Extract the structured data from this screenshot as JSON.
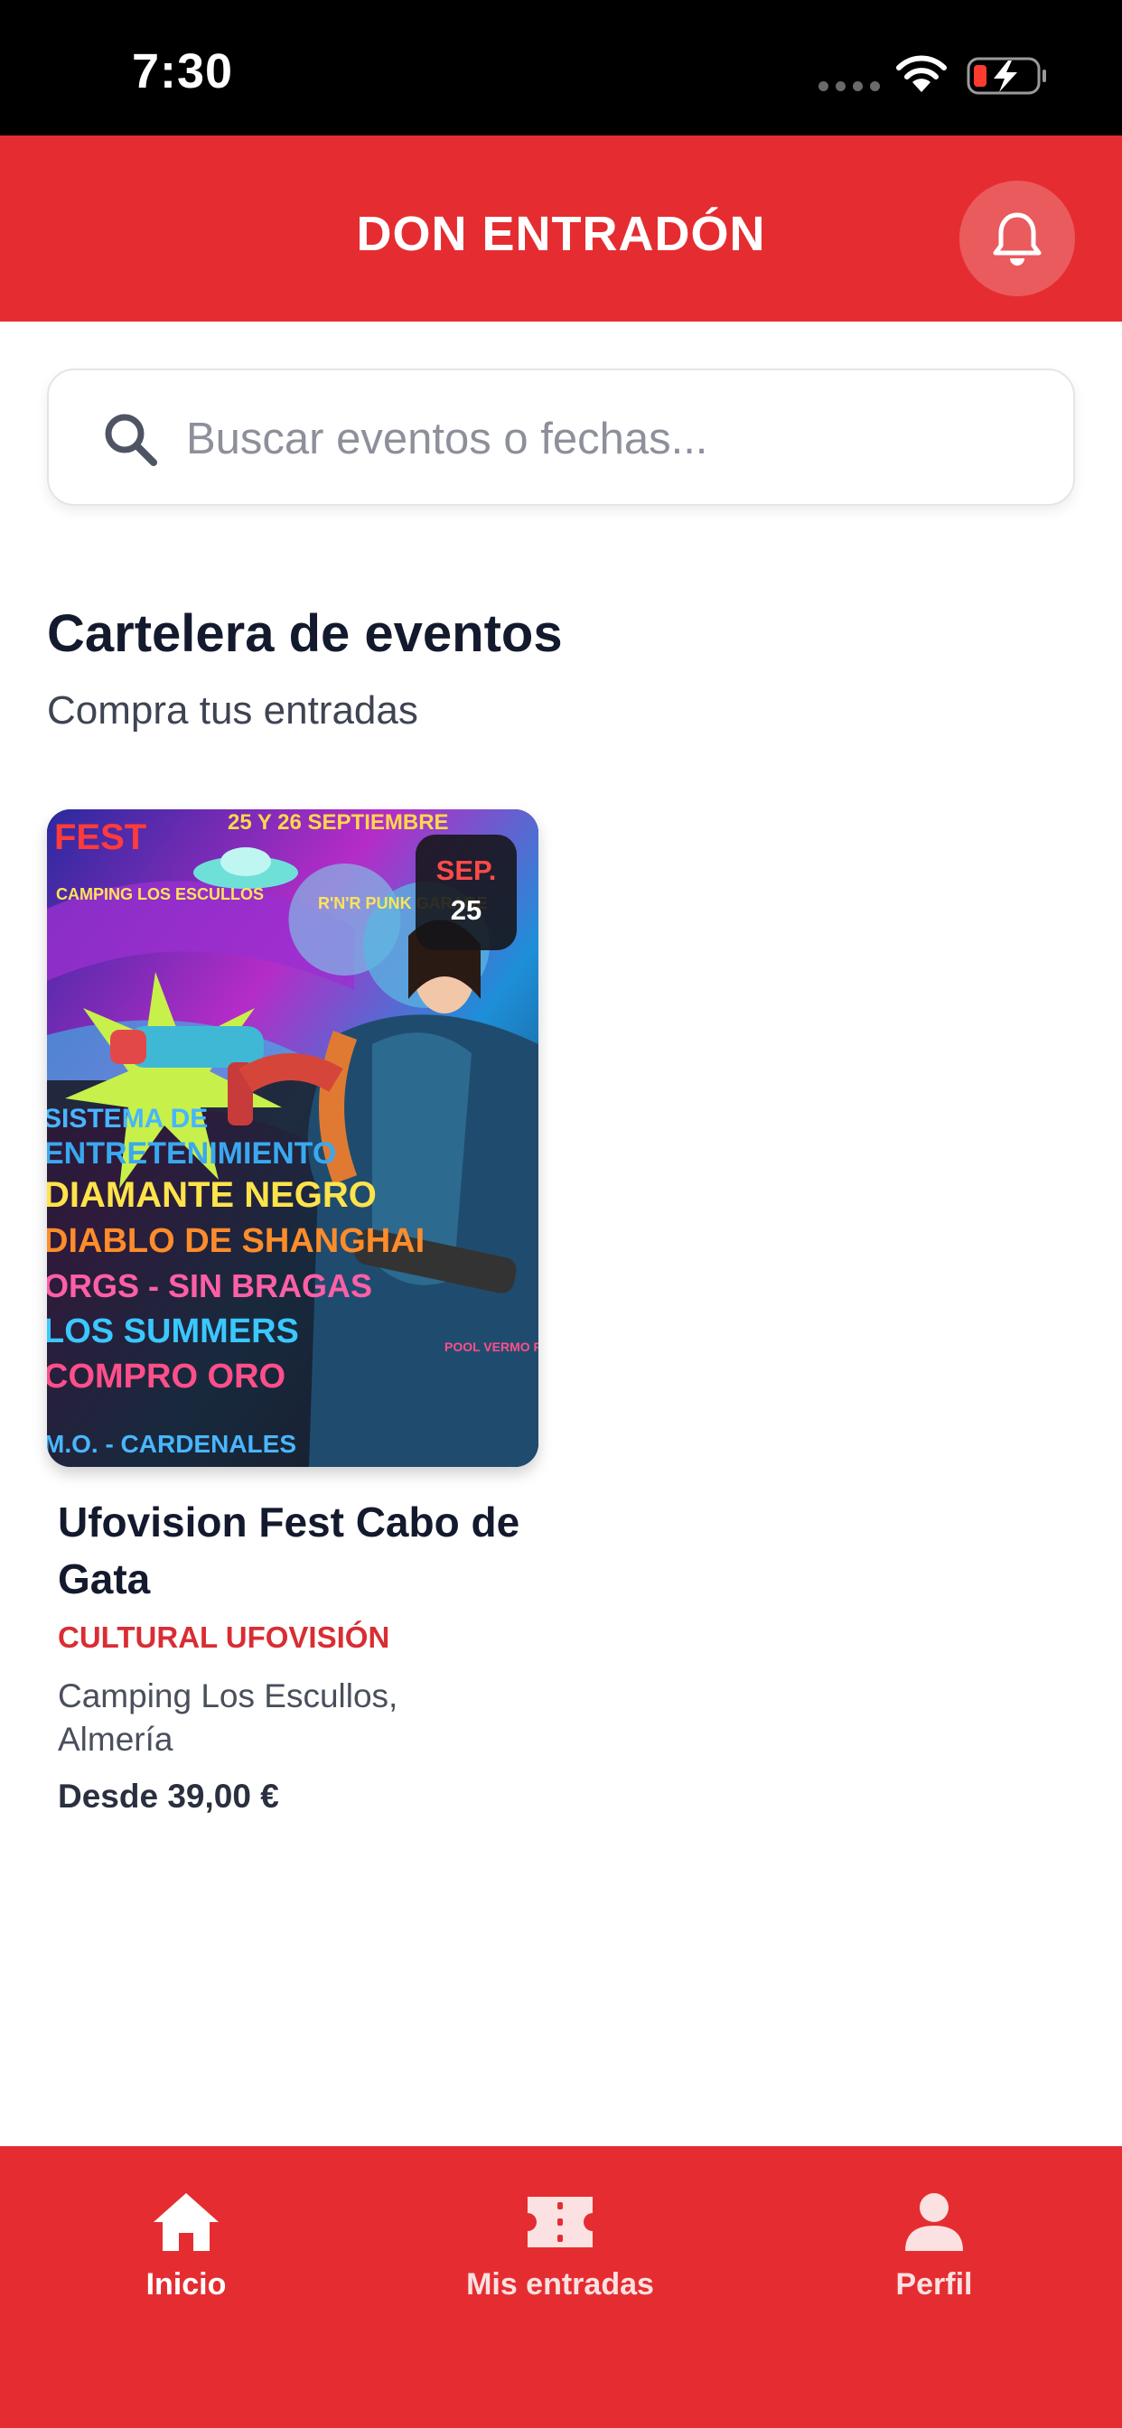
{
  "status_bar": {
    "time": "7:30",
    "wifi_icon": "wifi-icon",
    "battery_icon": "battery-charging-icon",
    "battery_color": "#ff3b30"
  },
  "header": {
    "title": "DON ENTRADÓN",
    "bell_icon": "bell-icon",
    "background": "#e52d31"
  },
  "search": {
    "placeholder": "Buscar eventos o fechas...",
    "value": "",
    "icon": "search-icon"
  },
  "section": {
    "title": "Cartelera de eventos",
    "subtitle": "Compra tus entradas"
  },
  "events": [
    {
      "date_month": "SEP.",
      "date_day": "25",
      "name": "Ufovision Fest Cabo de Gata",
      "organizer": "CULTURAL UFOVISIÓN",
      "location": "Camping Los Escullos, Almería",
      "price": "Desde 39,00 €",
      "poster": {
        "top_banner": "25 Y 26 SEPTIEMBRE",
        "fest": "FEST",
        "camping": "CAMPING LOS ESCULLOS",
        "genres": "R'N'R PUNK GARAGE",
        "lineup": [
          "SISTEMA DE",
          "ENTRETENIMIENTO",
          "DIAMANTE NEGRO",
          "DIABLO DE SHANGHAI",
          "ORGS - SIN BRAGAS",
          "LOS SUMMERS",
          "COMPRO ORO",
          "M.O. - CARDENALES"
        ],
        "side_text": "POOL VERMO PARTY + CONCURSO DE DISFRAZ"
      }
    }
  ],
  "bottom_nav": {
    "items": [
      {
        "label": "Inicio",
        "icon": "home-icon"
      },
      {
        "label": "Mis entradas",
        "icon": "ticket-icon"
      },
      {
        "label": "Perfil",
        "icon": "user-icon"
      }
    ]
  }
}
